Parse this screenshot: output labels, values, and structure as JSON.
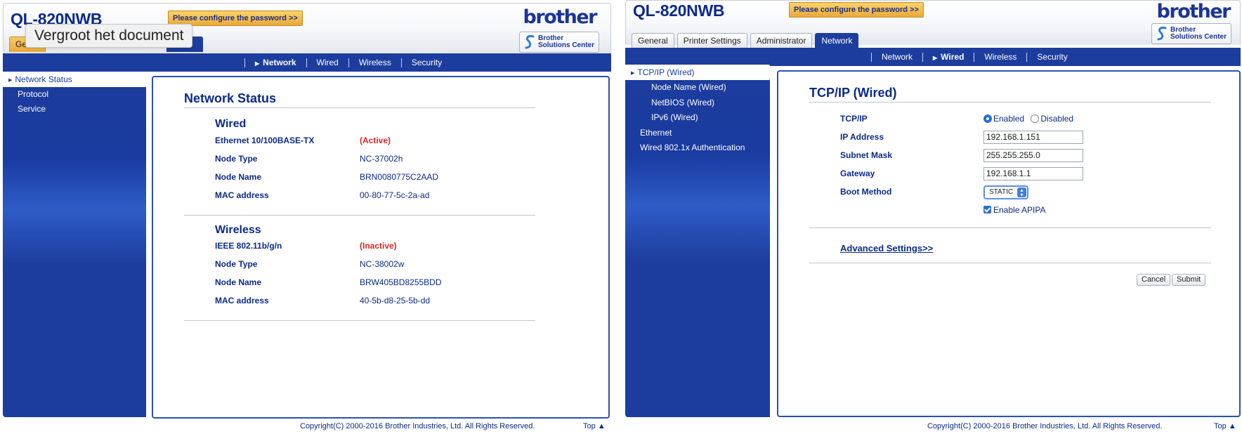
{
  "left": {
    "model": "QL-820NWB",
    "password_button": "Please configure the password >>",
    "brand": "brother",
    "solutions_center": [
      "Brother",
      "Solutions Center"
    ],
    "tooltip": "Vergroot het document",
    "visible_tabs": [
      "Ge",
      "rk"
    ],
    "subnav": [
      {
        "label": "Network",
        "active": true
      },
      {
        "label": "Wired",
        "active": false
      },
      {
        "label": "Wireless",
        "active": false
      },
      {
        "label": "Security",
        "active": false
      }
    ],
    "sidebar": [
      {
        "label": "Network Status",
        "active": true
      },
      {
        "label": "Protocol",
        "active": false
      },
      {
        "label": "Service",
        "active": false
      }
    ],
    "content_title": "Network Status",
    "wired": {
      "heading": "Wired",
      "rows": [
        {
          "label": "Ethernet 10/100BASE-TX",
          "value": "(Active)"
        },
        {
          "label": "Node Type",
          "value": "NC-37002h"
        },
        {
          "label": "Node Name",
          "value": "BRN0080775C2AAD"
        },
        {
          "label": "MAC address",
          "value": "00-80-77-5c-2a-ad"
        }
      ]
    },
    "wireless": {
      "heading": "Wireless",
      "rows": [
        {
          "label": "IEEE 802.11b/g/n",
          "value": "(Inactive)"
        },
        {
          "label": "Node Type",
          "value": "NC-38002w"
        },
        {
          "label": "Node Name",
          "value": "BRW405BD8255BDD"
        },
        {
          "label": "MAC address",
          "value": "40-5b-d8-25-5b-dd"
        }
      ]
    },
    "copyright": "Copyright(C) 2000-2016 Brother Industries, Ltd. All Rights Reserved.",
    "top_link": "Top"
  },
  "right": {
    "model": "QL-820NWB",
    "password_button": "Please configure the password >>",
    "brand": "brother",
    "solutions_center": [
      "Brother",
      "Solutions Center"
    ],
    "tabs": [
      {
        "label": "General",
        "active": false
      },
      {
        "label": "Printer Settings",
        "active": false
      },
      {
        "label": "Administrator",
        "active": false
      },
      {
        "label": "Network",
        "active": true
      }
    ],
    "subnav": [
      {
        "label": "Network",
        "active": false
      },
      {
        "label": "Wired",
        "active": true
      },
      {
        "label": "Wireless",
        "active": false
      },
      {
        "label": "Security",
        "active": false
      }
    ],
    "sidebar": [
      {
        "label": "TCP/IP (Wired)",
        "active": true,
        "sub": false
      },
      {
        "label": "Node Name (Wired)",
        "active": false,
        "sub": true
      },
      {
        "label": "NetBIOS (Wired)",
        "active": false,
        "sub": true
      },
      {
        "label": "IPv6 (Wired)",
        "active": false,
        "sub": true
      },
      {
        "label": "Ethernet",
        "active": false,
        "sub": false
      },
      {
        "label": "Wired 802.1x Authentication",
        "active": false,
        "sub": false
      }
    ],
    "content_title": "TCP/IP (Wired)",
    "form": {
      "tcpip_label": "TCP/IP",
      "tcpip_enabled": "Enabled",
      "tcpip_disabled": "Disabled",
      "ip_label": "IP Address",
      "ip_value": "192.168.1.151",
      "subnet_label": "Subnet Mask",
      "subnet_value": "255.255.255.0",
      "gateway_label": "Gateway",
      "gateway_value": "192.168.1.1",
      "boot_label": "Boot Method",
      "boot_value": "STATIC",
      "apipa_label": "Enable APIPA"
    },
    "advanced_link": "Advanced Settings>>",
    "cancel_button": "Cancel",
    "submit_button": "Submit",
    "copyright": "Copyright(C) 2000-2016 Brother Industries, Ltd. All Rights Reserved.",
    "top_link": "Top"
  },
  "colors": {
    "navy": "#1c3d9d",
    "title_text": "#0b2a8a",
    "status_red": "#d42a1f",
    "password_button": "#f0b347",
    "active_radio": "#2b6fd6"
  }
}
